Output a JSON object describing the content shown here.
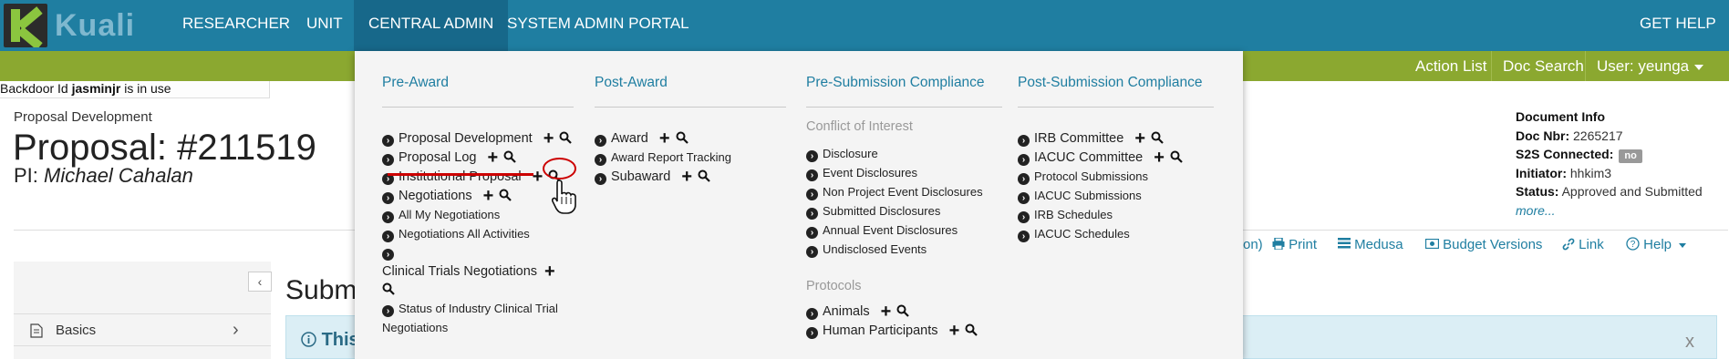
{
  "topnav": {
    "logo_text": "Kuali",
    "items": [
      "RESEARCHER",
      "UNIT",
      "CENTRAL ADMIN",
      "SYSTEM ADMIN PORTAL"
    ],
    "get_help": "GET HELP"
  },
  "greenbar": {
    "action_list": "Action List",
    "doc_search": "Doc Search",
    "user": "User: yeunga"
  },
  "backdoor": {
    "prefix": "Backdoor Id ",
    "user": "jasminjr",
    "suffix": " is in use"
  },
  "document": {
    "section": "Proposal Development",
    "title": "Proposal: #211519",
    "pi_label": "PI: ",
    "pi_name": "Michael Cahalan"
  },
  "docinfo": {
    "heading": "Document Info",
    "doc_nbr_label": "Doc Nbr:",
    "doc_nbr": "2265217",
    "s2s_label": "S2S Connected:",
    "s2s_value": "no",
    "initiator_label": "Initiator:",
    "initiator": "hhkim3",
    "status_label": "Status:",
    "status": "Approved and Submitted",
    "more": "more..."
  },
  "toolbar": {
    "partial": "on)",
    "print": "Print",
    "medusa": "Medusa",
    "budget_versions": "Budget Versions",
    "link": "Link",
    "help": "Help"
  },
  "sidebar": {
    "collapse": "‹",
    "basics": "Basics",
    "chevron": "›"
  },
  "main": {
    "title": "Subm",
    "info_text": "This",
    "close": "x"
  },
  "menu": {
    "pre_award": {
      "heading": "Pre-Award",
      "items": [
        "Proposal Development",
        "Proposal Log",
        "Institutional Proposal",
        "Negotiations",
        "All My Negotiations",
        "Negotiations All Activities",
        "Clinical Trials Negotiations",
        "Status of Industry Clinical Trial",
        "Negotiations"
      ]
    },
    "post_award": {
      "heading": "Post-Award",
      "items": [
        "Award",
        "Award Report Tracking",
        "Subaward"
      ]
    },
    "pre_submission": {
      "heading": "Pre-Submission Compliance",
      "coi_heading": "Conflict of Interest",
      "coi_items": [
        "Disclosure",
        "Event Disclosures",
        "Non Project Event Disclosures",
        "Submitted Disclosures",
        "Annual Event Disclosures",
        "Undisclosed Events"
      ],
      "protocols_heading": "Protocols",
      "protocol_items": [
        "Animals",
        "Human Participants"
      ]
    },
    "post_submission": {
      "heading": "Post-Submission Compliance",
      "items": [
        "IRB Committee",
        "IACUC Committee",
        "Protocol Submissions",
        "IACUC Submissions",
        "IRB Schedules",
        "IACUC Schedules"
      ]
    }
  },
  "icons": {
    "chevron": "›",
    "plus": "+"
  },
  "colors": {
    "nav_bg": "#1f7ea1",
    "green_bar": "#8ba830",
    "annotation": "#cc0000"
  }
}
